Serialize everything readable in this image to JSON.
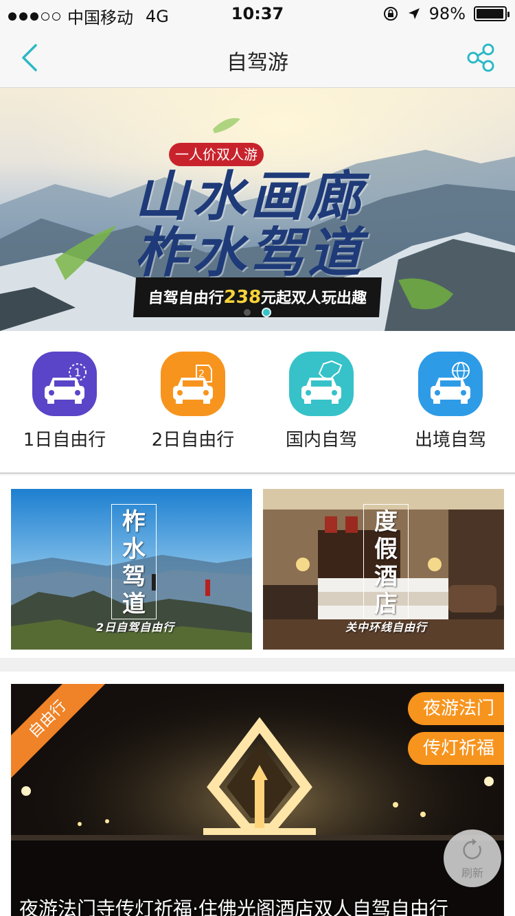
{
  "status_bar": {
    "carrier": "中国移动",
    "network": "4G",
    "time": "10:37",
    "battery_percent": "98%",
    "battery_level": 0.98,
    "signal_bars_filled": 3,
    "signal_bars_total": 5,
    "icons": [
      "orientation-lock-icon",
      "location-arrow-icon",
      "battery-icon"
    ]
  },
  "nav": {
    "title": "自驾游",
    "back_icon": "chevron-left-icon",
    "share_icon": "share-icon",
    "accent_color": "#2bb8c6"
  },
  "banner": {
    "badge": "一人价双人游",
    "title_line1": "山水画廊",
    "title_line2": "柞水驾道",
    "slogan_prefix": "自驾自由行",
    "slogan_price": "238",
    "slogan_suffix": "元起双人玩出趣",
    "slide_count": 2,
    "active_slide": 2
  },
  "categories": [
    {
      "label": "1日自由行",
      "icon": "car-one-day-icon",
      "color": "#5a45c8"
    },
    {
      "label": "2日自由行",
      "icon": "car-two-day-icon",
      "color": "#f7941e"
    },
    {
      "label": "国内自驾",
      "icon": "car-china-map-icon",
      "color": "#36c2c8"
    },
    {
      "label": "出境自驾",
      "icon": "car-globe-icon",
      "color": "#2e9be6"
    }
  ],
  "promos": [
    {
      "vertical_text": "柞水驾道",
      "subtitle": "2日自驾自由行"
    },
    {
      "vertical_text": "度假酒店",
      "subtitle": "关中环线自由行"
    }
  ],
  "feature": {
    "ribbon": "自由行",
    "tags": [
      "夜游法门",
      "传灯祈福"
    ],
    "caption": "夜游法门寺传灯祈福·住佛光阁酒店双人自驾自由行",
    "ribbon_color": "#f08227",
    "tag_color": "#f7941e"
  },
  "refresh_button": {
    "label": "刷新",
    "icon": "refresh-icon"
  }
}
